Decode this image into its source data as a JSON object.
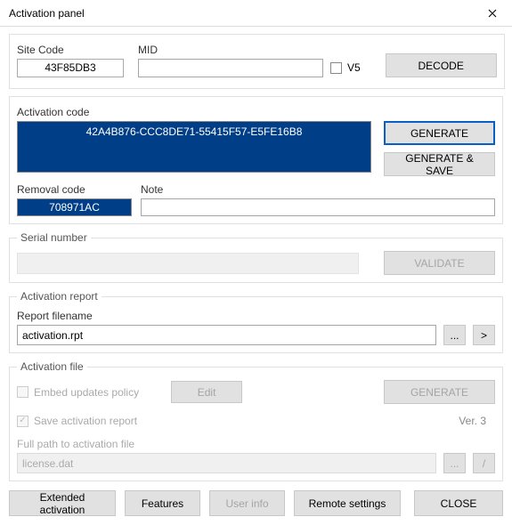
{
  "window": {
    "title": "Activation panel"
  },
  "section1": {
    "site_code_label": "Site Code",
    "site_code_value": "43F85DB3",
    "mid_label": "MID",
    "mid_value": "",
    "v5_label": "V5",
    "v5_checked": false,
    "decode_btn": "DECODE"
  },
  "section2": {
    "activation_code_label": "Activation code",
    "activation_code_value": "42A4B876-CCC8DE71-55415F57-E5FE16B8",
    "generate_btn": "GENERATE",
    "generate_save_btn": "GENERATE & SAVE",
    "removal_code_label": "Removal code",
    "removal_code_value": "708971AC",
    "note_label": "Note",
    "note_value": ""
  },
  "section3": {
    "legend": "Serial number",
    "serial_value": "",
    "validate_btn": "VALIDATE"
  },
  "section4": {
    "legend": "Activation report",
    "filename_label": "Report filename",
    "filename_value": "activation.rpt",
    "browse_btn": "...",
    "go_btn": ">"
  },
  "section5": {
    "legend": "Activation file",
    "embed_label": "Embed updates policy",
    "edit_btn": "Edit",
    "generate_btn": "GENERATE",
    "save_report_label": "Save activation report",
    "save_report_checked": true,
    "version_label": "Ver.  3",
    "fullpath_label": "Full path to activation file",
    "fullpath_value": "license.dat",
    "browse_btn": "...",
    "go_btn": "/"
  },
  "bottom": {
    "extended": "Extended activation",
    "features": "Features",
    "userinfo": "User info",
    "remote": "Remote settings",
    "close": "CLOSE"
  }
}
